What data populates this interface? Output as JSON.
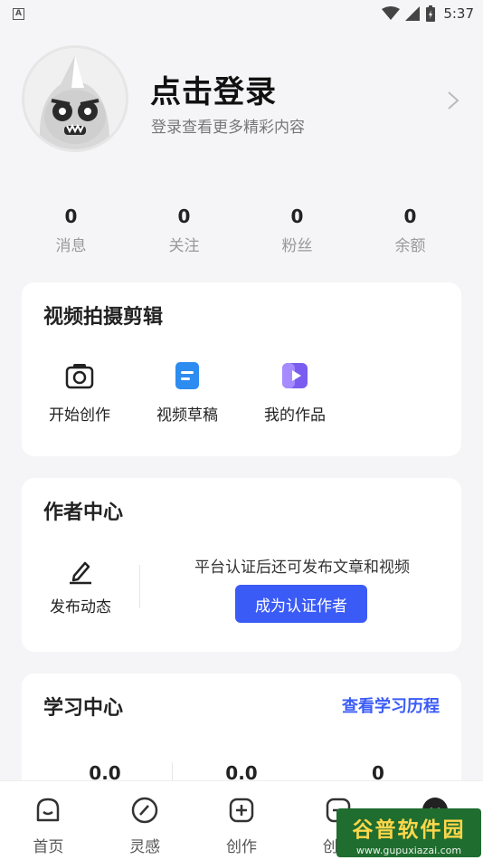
{
  "status_bar": {
    "time": "5:37"
  },
  "profile": {
    "title": "点击登录",
    "subtitle": "登录查看更多精彩内容"
  },
  "stats": [
    {
      "value": "0",
      "label": "消息"
    },
    {
      "value": "0",
      "label": "关注"
    },
    {
      "value": "0",
      "label": "粉丝"
    },
    {
      "value": "0",
      "label": "余额"
    }
  ],
  "video_card": {
    "title": "视频拍摄剪辑",
    "tools": [
      {
        "label": "开始创作",
        "icon": "camera-icon"
      },
      {
        "label": "视频草稿",
        "icon": "draft-icon"
      },
      {
        "label": "我的作品",
        "icon": "my-works-icon"
      }
    ]
  },
  "author_card": {
    "title": "作者中心",
    "post_label": "发布动态",
    "hint": "平台认证后还可发布文章和视频",
    "cert_button": "成为认证作者"
  },
  "learning_card": {
    "title": "学习中心",
    "history_link": "查看学习历程",
    "values": [
      "0.0",
      "0.0",
      "0"
    ]
  },
  "tabs": [
    {
      "label": "首页",
      "icon": "home-icon"
    },
    {
      "label": "灵感",
      "icon": "inspiration-icon"
    },
    {
      "label": "创作",
      "icon": "create-icon"
    },
    {
      "label": "创意",
      "icon": "creative-icon"
    }
  ],
  "watermark": {
    "title": "谷普软件园",
    "url": "www.gupuxiazai.com"
  },
  "colors": {
    "accent": "#3b5bf6",
    "background": "#f5f5f7"
  }
}
